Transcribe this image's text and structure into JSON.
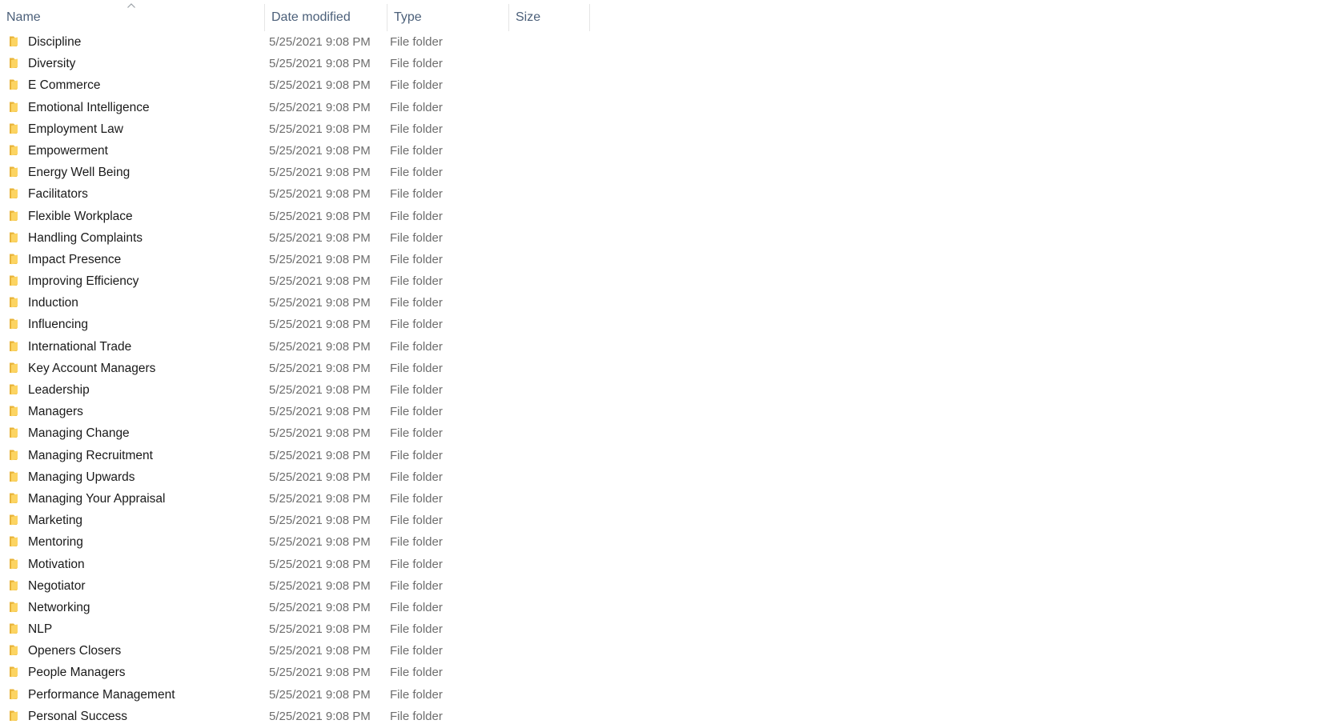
{
  "columns": {
    "name": "Name",
    "date_modified": "Date modified",
    "type": "Type",
    "size": "Size"
  },
  "sort": {
    "column": "name",
    "direction": "ascending"
  },
  "icon_colors": {
    "folder_back": "#e8b43a",
    "folder_front": "#fcd462"
  },
  "files": [
    {
      "name": "Discipline",
      "date": "5/25/2021 9:08 PM",
      "type": "File folder",
      "size": ""
    },
    {
      "name": "Diversity",
      "date": "5/25/2021 9:08 PM",
      "type": "File folder",
      "size": ""
    },
    {
      "name": "E Commerce",
      "date": "5/25/2021 9:08 PM",
      "type": "File folder",
      "size": ""
    },
    {
      "name": "Emotional Intelligence",
      "date": "5/25/2021 9:08 PM",
      "type": "File folder",
      "size": ""
    },
    {
      "name": "Employment Law",
      "date": "5/25/2021 9:08 PM",
      "type": "File folder",
      "size": ""
    },
    {
      "name": "Empowerment",
      "date": "5/25/2021 9:08 PM",
      "type": "File folder",
      "size": ""
    },
    {
      "name": "Energy Well Being",
      "date": "5/25/2021 9:08 PM",
      "type": "File folder",
      "size": ""
    },
    {
      "name": "Facilitators",
      "date": "5/25/2021 9:08 PM",
      "type": "File folder",
      "size": ""
    },
    {
      "name": "Flexible Workplace",
      "date": "5/25/2021 9:08 PM",
      "type": "File folder",
      "size": ""
    },
    {
      "name": "Handling Complaints",
      "date": "5/25/2021 9:08 PM",
      "type": "File folder",
      "size": ""
    },
    {
      "name": "Impact Presence",
      "date": "5/25/2021 9:08 PM",
      "type": "File folder",
      "size": ""
    },
    {
      "name": "Improving Efficiency",
      "date": "5/25/2021 9:08 PM",
      "type": "File folder",
      "size": ""
    },
    {
      "name": "Induction",
      "date": "5/25/2021 9:08 PM",
      "type": "File folder",
      "size": ""
    },
    {
      "name": "Influencing",
      "date": "5/25/2021 9:08 PM",
      "type": "File folder",
      "size": ""
    },
    {
      "name": "International Trade",
      "date": "5/25/2021 9:08 PM",
      "type": "File folder",
      "size": ""
    },
    {
      "name": "Key Account Managers",
      "date": "5/25/2021 9:08 PM",
      "type": "File folder",
      "size": ""
    },
    {
      "name": "Leadership",
      "date": "5/25/2021 9:08 PM",
      "type": "File folder",
      "size": ""
    },
    {
      "name": "Managers",
      "date": "5/25/2021 9:08 PM",
      "type": "File folder",
      "size": ""
    },
    {
      "name": "Managing Change",
      "date": "5/25/2021 9:08 PM",
      "type": "File folder",
      "size": ""
    },
    {
      "name": "Managing Recruitment",
      "date": "5/25/2021 9:08 PM",
      "type": "File folder",
      "size": ""
    },
    {
      "name": "Managing Upwards",
      "date": "5/25/2021 9:08 PM",
      "type": "File folder",
      "size": ""
    },
    {
      "name": "Managing Your Appraisal",
      "date": "5/25/2021 9:08 PM",
      "type": "File folder",
      "size": ""
    },
    {
      "name": "Marketing",
      "date": "5/25/2021 9:08 PM",
      "type": "File folder",
      "size": ""
    },
    {
      "name": "Mentoring",
      "date": "5/25/2021 9:08 PM",
      "type": "File folder",
      "size": ""
    },
    {
      "name": "Motivation",
      "date": "5/25/2021 9:08 PM",
      "type": "File folder",
      "size": ""
    },
    {
      "name": "Negotiator",
      "date": "5/25/2021 9:08 PM",
      "type": "File folder",
      "size": ""
    },
    {
      "name": "Networking",
      "date": "5/25/2021 9:08 PM",
      "type": "File folder",
      "size": ""
    },
    {
      "name": "NLP",
      "date": "5/25/2021 9:08 PM",
      "type": "File folder",
      "size": ""
    },
    {
      "name": "Openers Closers",
      "date": "5/25/2021 9:08 PM",
      "type": "File folder",
      "size": ""
    },
    {
      "name": "People Managers",
      "date": "5/25/2021 9:08 PM",
      "type": "File folder",
      "size": ""
    },
    {
      "name": "Performance Management",
      "date": "5/25/2021 9:08 PM",
      "type": "File folder",
      "size": ""
    },
    {
      "name": "Personal Success",
      "date": "5/25/2021 9:08 PM",
      "type": "File folder",
      "size": ""
    }
  ]
}
